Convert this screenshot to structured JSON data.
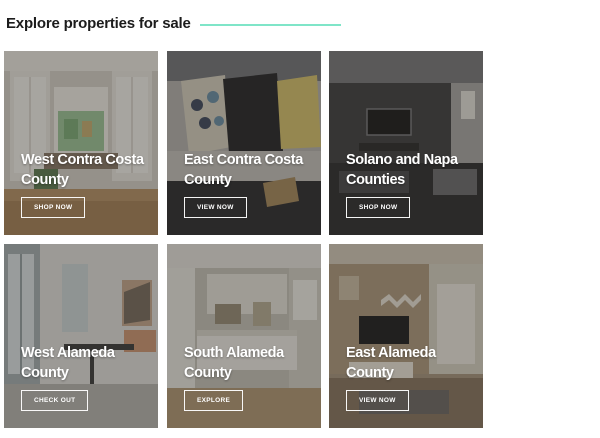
{
  "header": {
    "title": "Explore properties for sale",
    "accent_color": "#7fe5c8"
  },
  "cards": [
    {
      "name": "West Contra Costa County",
      "button": "SHOP NOW"
    },
    {
      "name": "East Contra Costa County",
      "button": "VIEW NOW"
    },
    {
      "name": "Solano and Napa Counties",
      "button": "SHOP NOW"
    },
    {
      "name": "West Alameda County",
      "button": "CHECK OUT"
    },
    {
      "name": "South Alameda County",
      "button": "EXPLORE"
    },
    {
      "name": "East Alameda County",
      "button": "VIEW NOW"
    }
  ]
}
